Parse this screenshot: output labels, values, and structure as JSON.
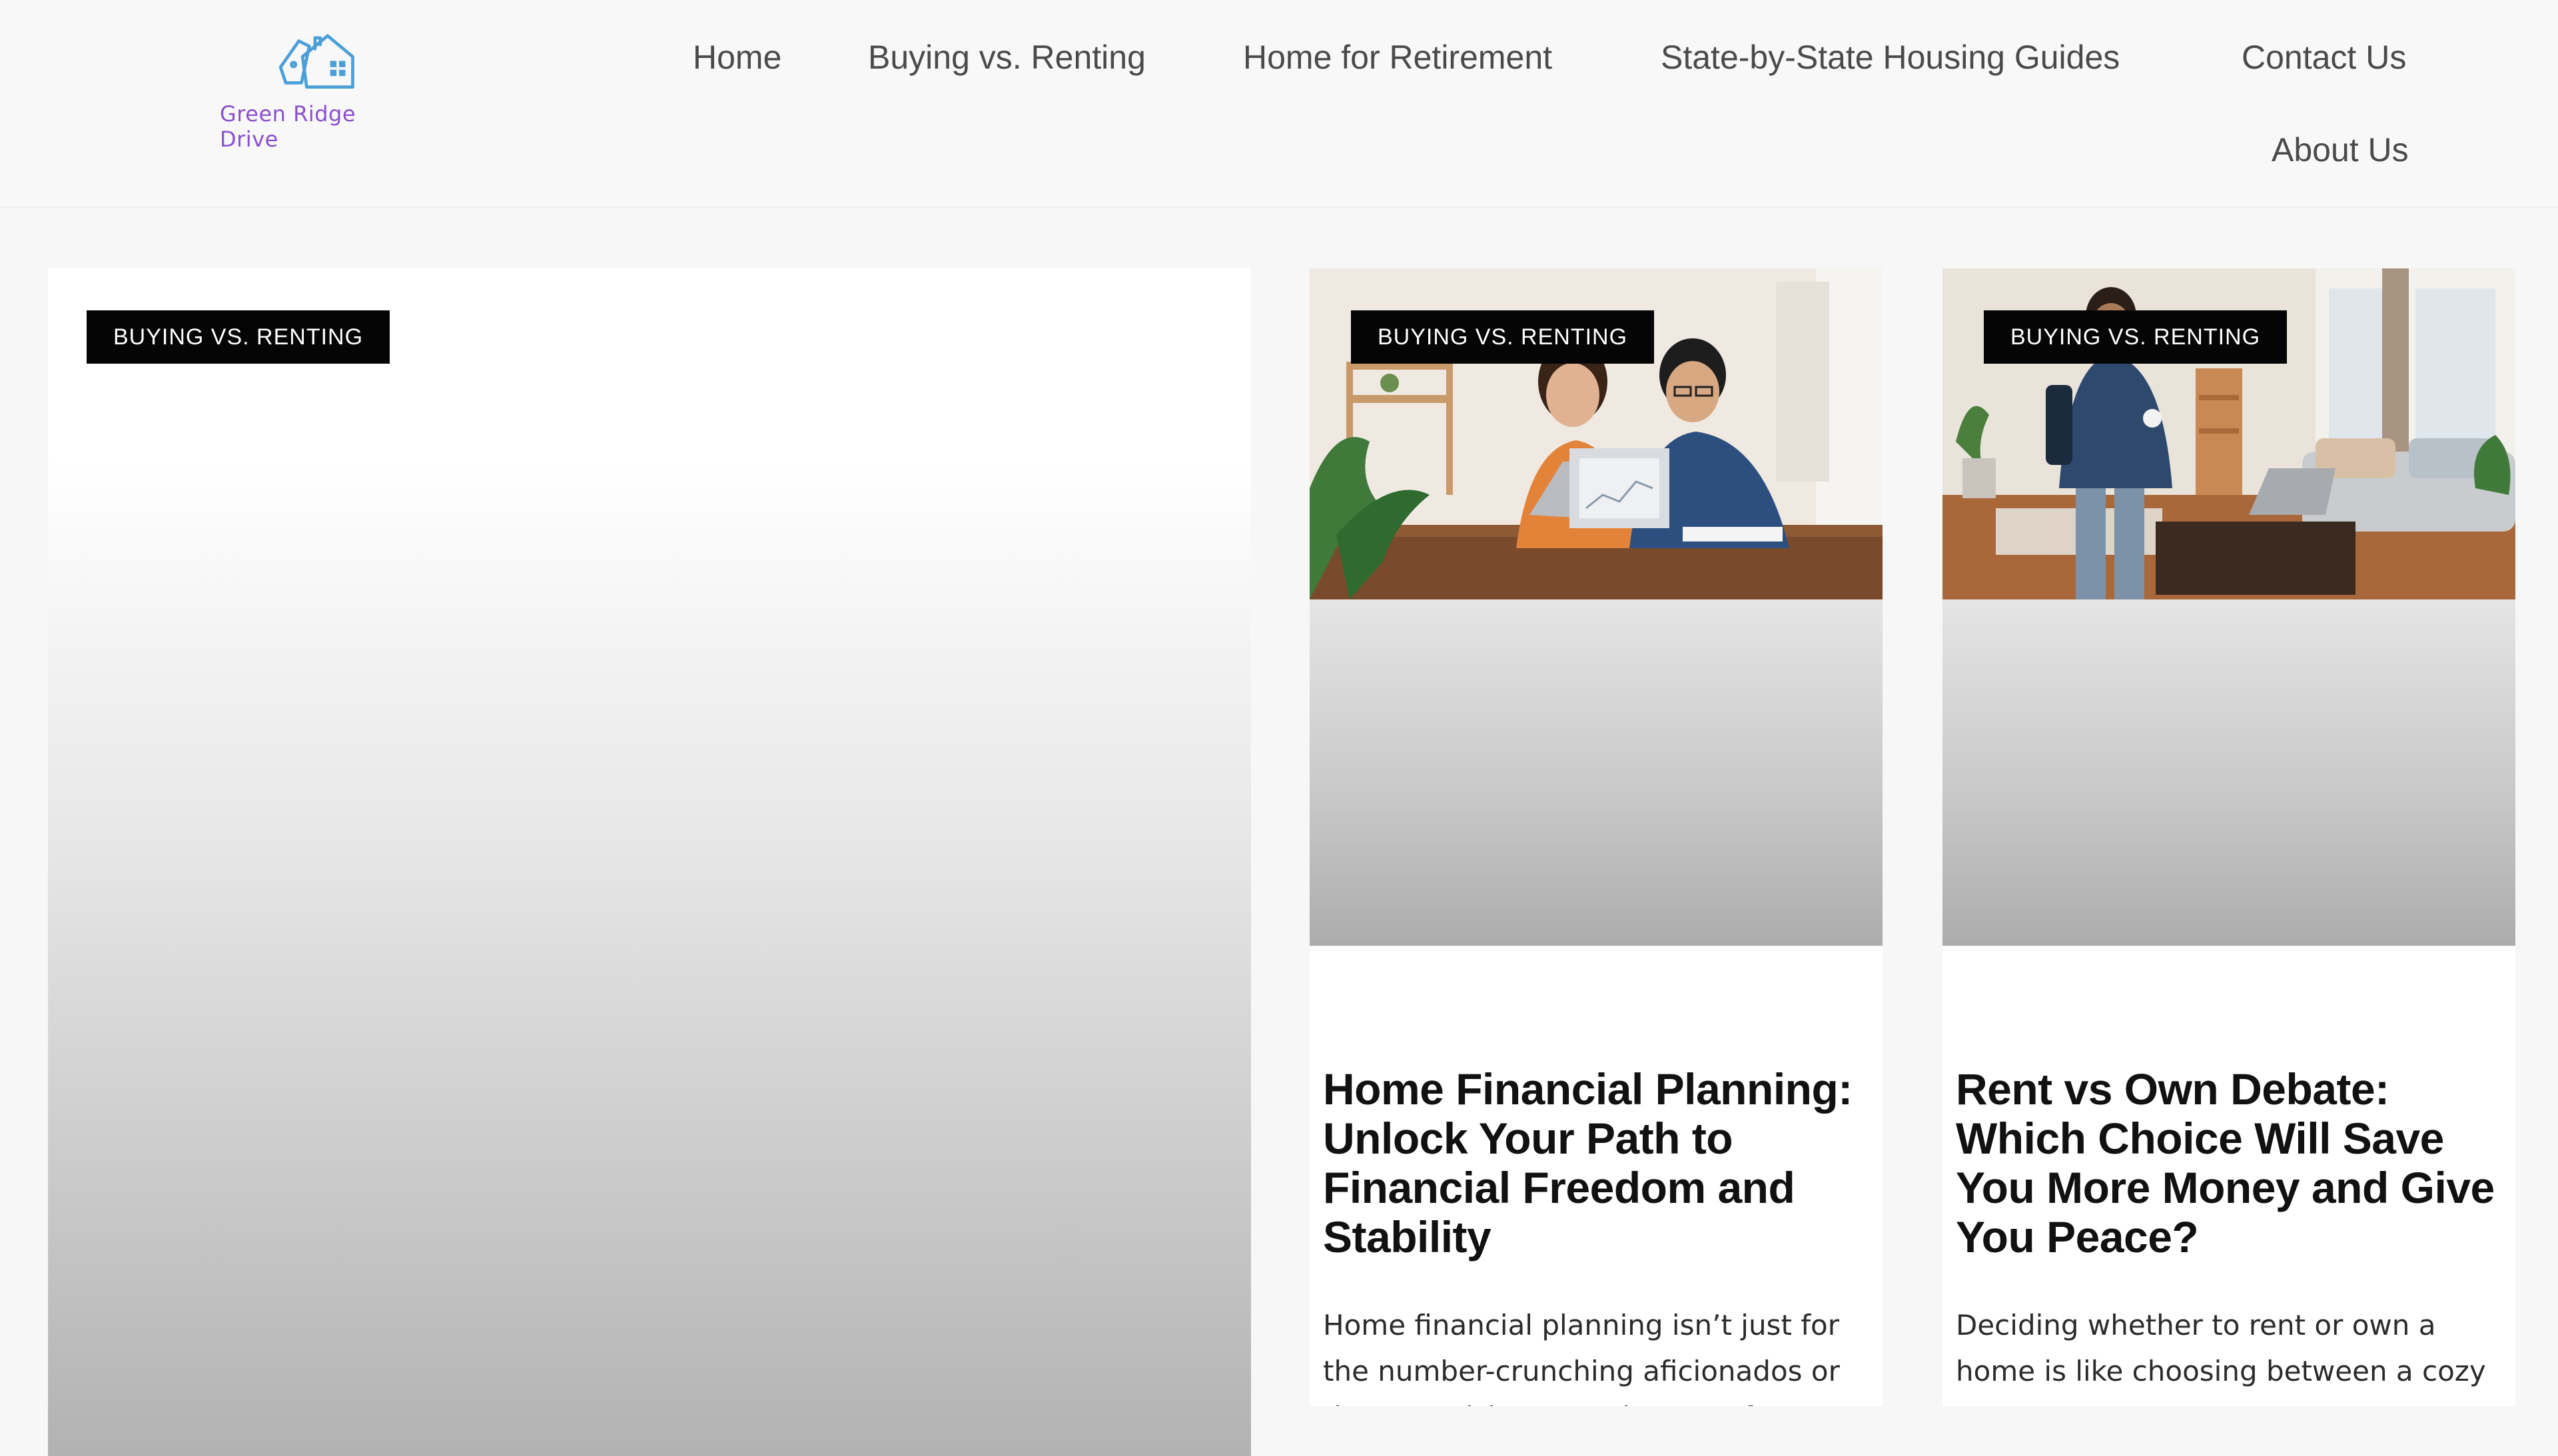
{
  "site": {
    "logo_text": "Green Ridge Drive",
    "logo_icon": "house-tag-icon",
    "brand_color": "#8a4fd0",
    "logo_line_color": "#4a9fd8"
  },
  "nav": {
    "items": [
      {
        "label": "Home"
      },
      {
        "label": "Buying vs. Renting"
      },
      {
        "label": "Home for Retirement"
      },
      {
        "label": "State-by-State Housing Guides"
      },
      {
        "label": "Contact Us"
      },
      {
        "label": "About Us"
      }
    ]
  },
  "posts": {
    "featured": {
      "category": "BUYING VS. RENTING"
    },
    "cards": [
      {
        "category": "BUYING VS. RENTING",
        "title": "Home Financial Planning: Unlock Your Path to Financial Freedom and Stability",
        "excerpt": "Home financial planning isn’t just for the number-crunching aficionados or the spreadsheet warriors. It’s for",
        "image": "couple-at-laptop-photo"
      },
      {
        "category": "BUYING VS. RENTING",
        "title": "Rent vs Own Debate: Which Choice Will Save You More Money and Give You Peace?",
        "excerpt": "Deciding whether to rent or own a home is like choosing between a cozy sweater",
        "image": "man-in-living-room-photo"
      }
    ]
  }
}
